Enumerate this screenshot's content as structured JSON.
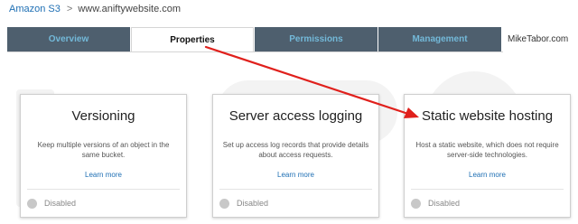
{
  "breadcrumb": {
    "root": "Amazon S3",
    "separator": ">",
    "current": "www.aniftywebsite.com"
  },
  "tabs": [
    {
      "label": "Overview",
      "active": false
    },
    {
      "label": "Properties",
      "active": true
    },
    {
      "label": "Permissions",
      "active": false
    },
    {
      "label": "Management",
      "active": false
    }
  ],
  "brand": "MikeTabor.com",
  "cards": [
    {
      "title": "Versioning",
      "description": "Keep multiple versions of an object in the same bucket.",
      "link": "Learn more",
      "status": "Disabled"
    },
    {
      "title": "Server access logging",
      "description": "Set up access log records that provide details about access requests.",
      "link": "Learn more",
      "status": "Disabled"
    },
    {
      "title": "Static website hosting",
      "description": "Host a static website, which does not require server-side technologies.",
      "link": "Learn more",
      "status": "Disabled"
    }
  ],
  "annotation": {
    "arrow_color": "#e0201c",
    "from": "tab-properties",
    "to": "card-static-website-hosting"
  },
  "colors": {
    "tab_bg": "#4e5f6e",
    "tab_text": "#73b9d9",
    "link": "#1e6fb4"
  }
}
